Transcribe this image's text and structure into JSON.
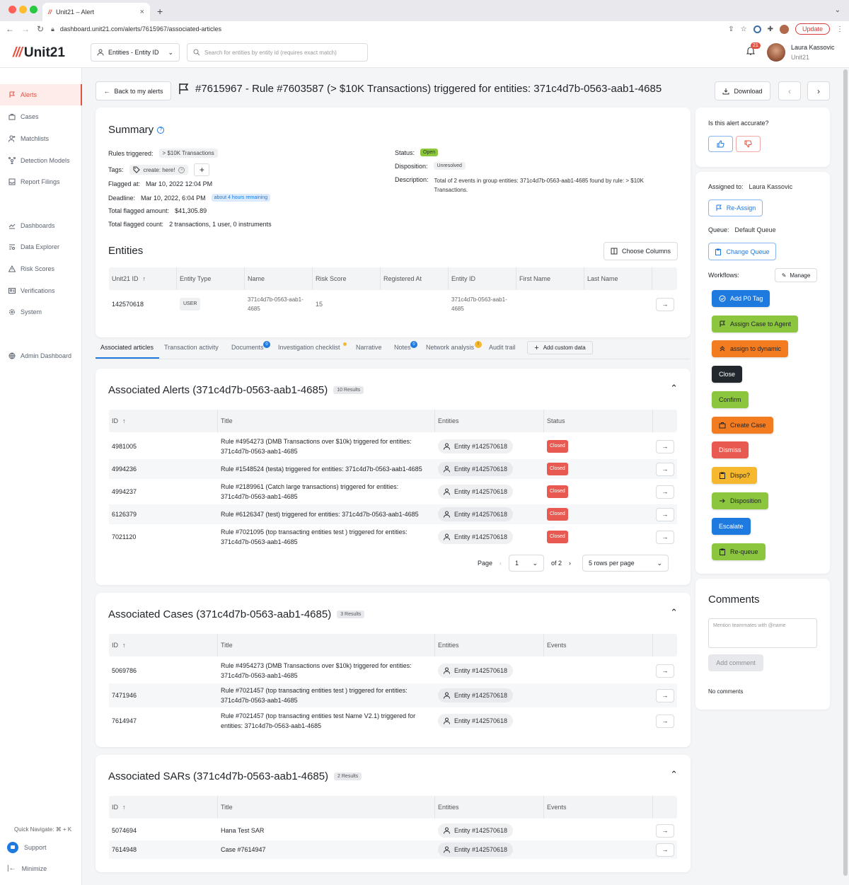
{
  "browser": {
    "tab_title": "Unit21 – Alert",
    "url": "dashboard.unit21.com/alerts/7615967/associated-articles",
    "update_label": "Update"
  },
  "header": {
    "logo_text": "Unit21",
    "entity_select": "Entities - Entity ID",
    "search_placeholder": "Search for entities by entity id (requires exact match)",
    "notification_count": "21",
    "user_name": "Laura Kassovic",
    "user_org": "Unit21"
  },
  "sidebar": {
    "items": [
      {
        "label": "Alerts",
        "icon": "flag-icon"
      },
      {
        "label": "Cases",
        "icon": "briefcase-icon"
      },
      {
        "label": "Matchlists",
        "icon": "user-plus-icon"
      },
      {
        "label": "Detection Models",
        "icon": "network-icon"
      },
      {
        "label": "Report Filings",
        "icon": "inbox-icon"
      },
      {
        "label": "Dashboards",
        "icon": "chart-icon"
      },
      {
        "label": "Data Explorer",
        "icon": "table-search-icon"
      },
      {
        "label": "Risk Scores",
        "icon": "warning-icon"
      },
      {
        "label": "Verifications",
        "icon": "id-card-icon"
      },
      {
        "label": "System",
        "icon": "gear-icon"
      },
      {
        "label": "Admin Dashboard",
        "icon": "globe-icon"
      }
    ],
    "quick_navigate": "Quick Navigate: ⌘ + K",
    "support": "Support",
    "minimize": "Minimize"
  },
  "titlebar": {
    "back_label": "Back to my alerts",
    "title": "#7615967 - Rule #7603587 (> $10K Transactions) triggered for entities: 371c4d7b-0563-aab1-4685",
    "download_label": "Download"
  },
  "summary": {
    "heading": "Summary",
    "rules_triggered_label": "Rules triggered:",
    "rules_triggered": "> $10K Transactions",
    "tags_label": "Tags:",
    "tag": "create: here!",
    "flagged_at_label": "Flagged at:",
    "flagged_at": "Mar 10, 2022 12:04 PM",
    "deadline_label": "Deadline:",
    "deadline": "Mar 10, 2022, 6:04 PM",
    "deadline_badge": "about 4 hours remaining",
    "total_amount_label": "Total flagged amount:",
    "total_amount": "$41,305.89",
    "total_count_label": "Total flagged count:",
    "total_count": "2 transactions, 1 user, 0 instruments",
    "status_label": "Status:",
    "status": "Open",
    "disposition_label": "Disposition:",
    "disposition": "Unresolved",
    "description_label": "Description:",
    "description": "Total of 2 events in group entities: 371c4d7b-0563-aab1-4685 found by rule: > $10K Transactions."
  },
  "entities": {
    "heading": "Entities",
    "choose_columns": "Choose Columns",
    "columns": [
      "Unit21 ID",
      "Entity Type",
      "Name",
      "Risk Score",
      "Registered At",
      "Entity ID",
      "First Name",
      "Last Name"
    ],
    "rows": [
      {
        "unit21_id": "142570618",
        "type": "USER",
        "name": "371c4d7b-0563-aab1-4685",
        "risk": "15",
        "registered": "",
        "entity_id": "371c4d7b-0563-aab1-4685",
        "first": "",
        "last": ""
      }
    ]
  },
  "tabs": [
    {
      "label": "Associated articles",
      "badge": ""
    },
    {
      "label": "Transaction activity",
      "badge": ""
    },
    {
      "label": "Documents",
      "badge": "0"
    },
    {
      "label": "Investigation checklist",
      "badge": ""
    },
    {
      "label": "Narrative",
      "badge": ""
    },
    {
      "label": "Notes",
      "badge": "0"
    },
    {
      "label": "Network analysis",
      "badge": "!"
    },
    {
      "label": "Audit trail",
      "badge": ""
    },
    {
      "label": "Add custom data",
      "badge": ""
    }
  ],
  "alerts": {
    "heading": "Associated Alerts (371c4d7b-0563-aab1-4685)",
    "count": "10 Results",
    "columns": [
      "ID",
      "Title",
      "Entities",
      "Status"
    ],
    "rows": [
      {
        "id": "4981005",
        "title": "Rule #4954273 (DMB Transactions over $10k) triggered for entities: 371c4d7b-0563-aab1-4685",
        "entity": "Entity #142570618",
        "status": "Closed"
      },
      {
        "id": "4994236",
        "title": "Rule #1548524 (testa) triggered for entities: 371c4d7b-0563-aab1-4685",
        "entity": "Entity #142570618",
        "status": "Closed"
      },
      {
        "id": "4994237",
        "title": "Rule #2189961 (Catch large transactions) triggered for entities: 371c4d7b-0563-aab1-4685",
        "entity": "Entity #142570618",
        "status": "Closed"
      },
      {
        "id": "6126379",
        "title": "Rule #6126347 (test) triggered for entities: 371c4d7b-0563-aab1-4685",
        "entity": "Entity #142570618",
        "status": "Closed"
      },
      {
        "id": "7021120",
        "title": "Rule #7021095 (top transacting entities test ) triggered for entities: 371c4d7b-0563-aab1-4685",
        "entity": "Entity #142570618",
        "status": "Closed"
      }
    ],
    "page_label": "Page",
    "page_value": "1",
    "of_pages": "of 2",
    "rows_per_page": "5 rows per page"
  },
  "cases": {
    "heading": "Associated Cases (371c4d7b-0563-aab1-4685)",
    "count": "3 Results",
    "columns": [
      "ID",
      "Title",
      "Entities",
      "Events"
    ],
    "rows": [
      {
        "id": "5069786",
        "title": "Rule #4954273 (DMB Transactions over $10k) triggered for entities: 371c4d7b-0563-aab1-4685",
        "entity": "Entity #142570618"
      },
      {
        "id": "7471946",
        "title": "Rule #7021457 (top transacting entities test ) triggered for entities: 371c4d7b-0563-aab1-4685",
        "entity": "Entity #142570618"
      },
      {
        "id": "7614947",
        "title": "Rule #7021457 (top transacting entities test Name V2.1) triggered for entities: 371c4d7b-0563-aab1-4685",
        "entity": "Entity #142570618"
      }
    ]
  },
  "sars": {
    "heading": "Associated SARs (371c4d7b-0563-aab1-4685)",
    "count": "2 Results",
    "columns": [
      "ID",
      "Title",
      "Entities",
      "Events"
    ],
    "rows": [
      {
        "id": "5074694",
        "title": "Hana Test SAR",
        "entity": "Entity #142570618"
      },
      {
        "id": "7614948",
        "title": "Case #7614947",
        "entity": "Entity #142570618"
      }
    ]
  },
  "accuracy": {
    "question": "Is this alert accurate?"
  },
  "assignment": {
    "assigned_label": "Assigned to:",
    "assigned_value": "Laura Kassovic",
    "reassign": "Re-Assign",
    "queue_label": "Queue:",
    "queue_value": "Default Queue",
    "change_queue": "Change Queue",
    "workflows_label": "Workflows:",
    "manage": "Manage",
    "workflows": [
      {
        "label": "Add P0 Tag",
        "color": "#1f7ae0",
        "text": "#ffffff",
        "icon": "check-circle-icon"
      },
      {
        "label": "Assign Case to Agent",
        "color": "#8cc63f",
        "text": "#1f2328",
        "icon": "flag-icon"
      },
      {
        "label": "assign to dynamic",
        "color": "#f47c20",
        "text": "#1f2328",
        "icon": "chevrons-up-icon"
      },
      {
        "label": "Close",
        "color": "#22272e",
        "text": "#ffffff",
        "icon": ""
      },
      {
        "label": "Confirm",
        "color": "#8cc63f",
        "text": "#1f2328",
        "icon": ""
      },
      {
        "label": "Create Case",
        "color": "#f47c20",
        "text": "#1f2328",
        "icon": "briefcase-icon"
      },
      {
        "label": "Dismiss",
        "color": "#e85a51",
        "text": "#ffffff",
        "icon": ""
      },
      {
        "label": "Dispo?",
        "color": "#f5b82e",
        "text": "#1f2328",
        "icon": "clipboard-icon"
      },
      {
        "label": "Disposition",
        "color": "#8cc63f",
        "text": "#1f2328",
        "icon": "arrow-right-icon"
      },
      {
        "label": "Escalate",
        "color": "#1f7ae0",
        "text": "#ffffff",
        "icon": ""
      },
      {
        "label": "Re-queue",
        "color": "#8cc63f",
        "text": "#1f2328",
        "icon": "clipboard-icon"
      }
    ]
  },
  "comments": {
    "heading": "Comments",
    "placeholder": "Mention teammates with @name",
    "add_label": "Add comment",
    "empty": "No comments"
  }
}
